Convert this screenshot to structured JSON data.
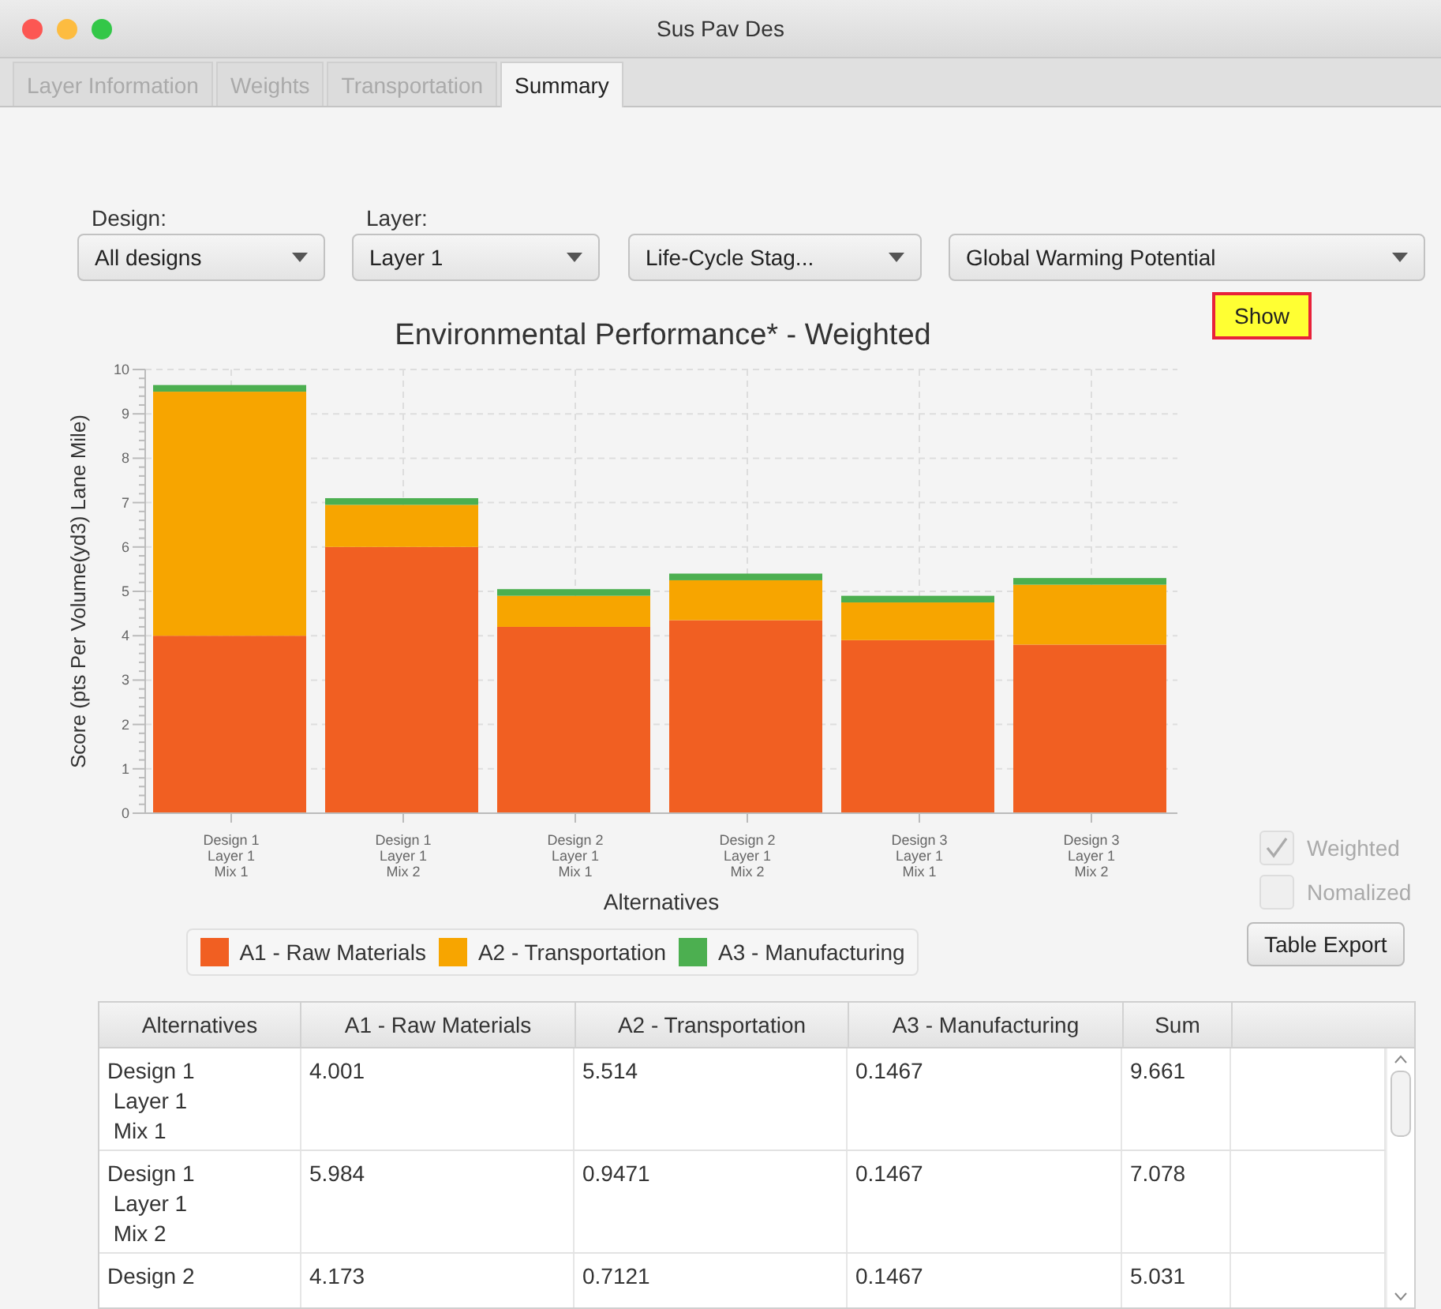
{
  "window": {
    "title": "Sus Pav Des"
  },
  "tabs": [
    {
      "label": "Layer Information",
      "selected": false
    },
    {
      "label": "Weights",
      "selected": false
    },
    {
      "label": "Transportation",
      "selected": false
    },
    {
      "label": "Summary",
      "selected": true
    }
  ],
  "filters": [
    {
      "label": "Design:",
      "value": "All designs"
    },
    {
      "label": "Layer:",
      "value": "Layer 1"
    },
    {
      "value": "Life-Cycle Stag..."
    },
    {
      "value": "Global Warming Potential"
    }
  ],
  "show_button": "Show",
  "chart": {
    "chart_data": {
      "type": "bar",
      "stacked": true,
      "title": "Environmental Performance* - Weighted",
      "xlabel": "Alternatives",
      "ylabel": "Score (pts Per Volume(yd3) Lane Mile)",
      "categories": [
        "Design 1\nLayer 1\nMix 1",
        "Design 1\nLayer 1\nMix 2",
        "Design 2\nLayer 1\nMix 1",
        "Design 2\nLayer 1\nMix 2",
        "Design 3\nLayer 1\nMix 1",
        "Design 3\nLayer 1\nMix 2"
      ],
      "series": [
        {
          "name": "A1 - Raw Materials",
          "color": "#f15f22",
          "values": [
            4.0,
            6.0,
            4.2,
            4.35,
            3.9,
            3.8
          ]
        },
        {
          "name": "A2 - Transportation",
          "color": "#f7a500",
          "values": [
            5.5,
            0.95,
            0.7,
            0.9,
            0.85,
            1.35
          ]
        },
        {
          "name": "A3 - Manufacturing",
          "color": "#4caf50",
          "values": [
            0.15,
            0.15,
            0.15,
            0.15,
            0.15,
            0.15
          ]
        }
      ],
      "grid": true,
      "ylim": [
        0,
        10
      ],
      "yticks": [
        0,
        1,
        2,
        3,
        4,
        5,
        6,
        7,
        8,
        9,
        10
      ]
    }
  },
  "options": [
    {
      "label": "Weighted",
      "checked": true,
      "disabled": true
    },
    {
      "label": "Nomalized",
      "checked": false,
      "disabled": true
    }
  ],
  "export_button": "Table Export",
  "table": {
    "columns": [
      "Alternatives",
      "A1 - Raw Materials",
      "A2 - Transportation",
      "A3 - Manufacturing",
      "Sum"
    ],
    "rows": [
      [
        "Design 1\n Layer 1\n Mix 1",
        "4.001",
        "5.514",
        "0.1467",
        "9.661"
      ],
      [
        "Design 1\n Layer 1\n Mix 2",
        "5.984",
        "0.9471",
        "0.1467",
        "7.078"
      ],
      [
        "Design 2",
        "4.173",
        "0.7121",
        "0.1467",
        "5.031"
      ]
    ]
  }
}
